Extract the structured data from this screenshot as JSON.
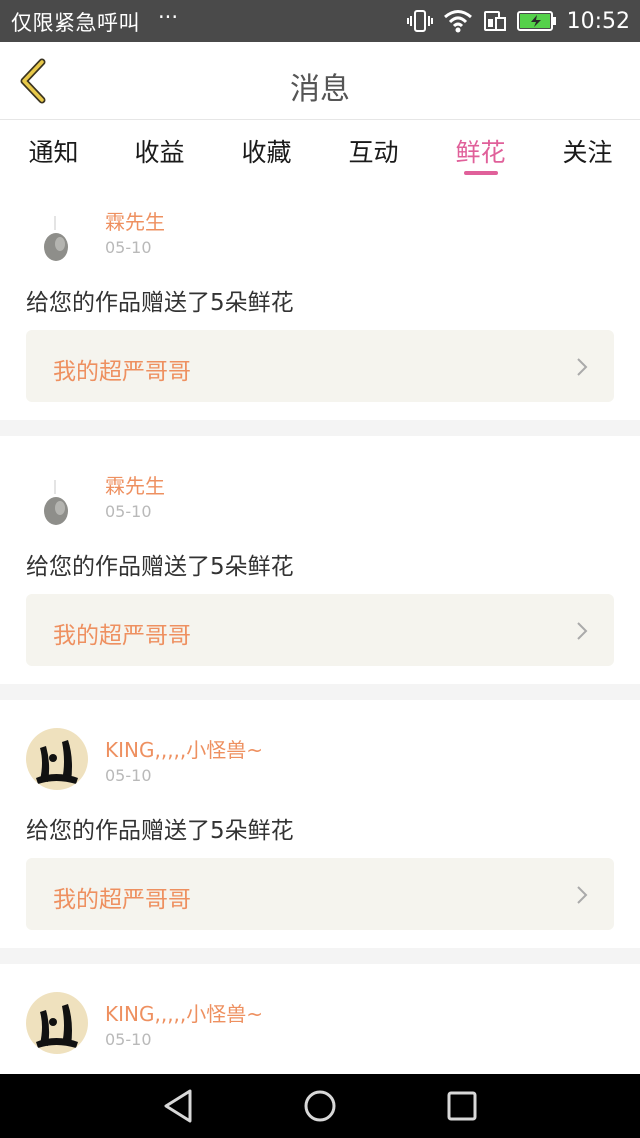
{
  "status_bar": {
    "left_text": "仅限紧急呼叫",
    "more": "···",
    "time": "10:52",
    "icons": [
      "vibrate-icon",
      "wifi-icon",
      "sim-icon",
      "battery-charging-icon"
    ]
  },
  "header": {
    "title": "消息",
    "back_icon": "chevron-left-icon"
  },
  "tabs": [
    {
      "label": "通知",
      "active": false
    },
    {
      "label": "收益",
      "active": false
    },
    {
      "label": "收藏",
      "active": false
    },
    {
      "label": "互动",
      "active": false
    },
    {
      "label": "鲜花",
      "active": true
    },
    {
      "label": "关注",
      "active": false
    }
  ],
  "colors": {
    "accent_pink": "#e0609a",
    "username_orange": "#ee9060",
    "card_bg": "#f5f4ee"
  },
  "messages": [
    {
      "user": "霖先生",
      "date": "05-10",
      "text": "给您的作品赠送了5朵鲜花",
      "work_title": "我的超严哥哥",
      "avatar": "ink-drop-avatar"
    },
    {
      "user": "霖先生",
      "date": "05-10",
      "text": "给您的作品赠送了5朵鲜花",
      "work_title": "我的超严哥哥",
      "avatar": "ink-drop-avatar"
    },
    {
      "user": "KING,,,,,小怪兽~",
      "date": "05-10",
      "text": "给您的作品赠送了5朵鲜花",
      "work_title": "我的超严哥哥",
      "avatar": "calligraphy-avatar"
    },
    {
      "user": "KING,,,,,小怪兽~",
      "date": "05-10",
      "text": "",
      "work_title": "",
      "avatar": "calligraphy-avatar"
    }
  ],
  "nav_bar": {
    "buttons": [
      "back-triangle-icon",
      "home-circle-icon",
      "recents-square-icon"
    ]
  }
}
